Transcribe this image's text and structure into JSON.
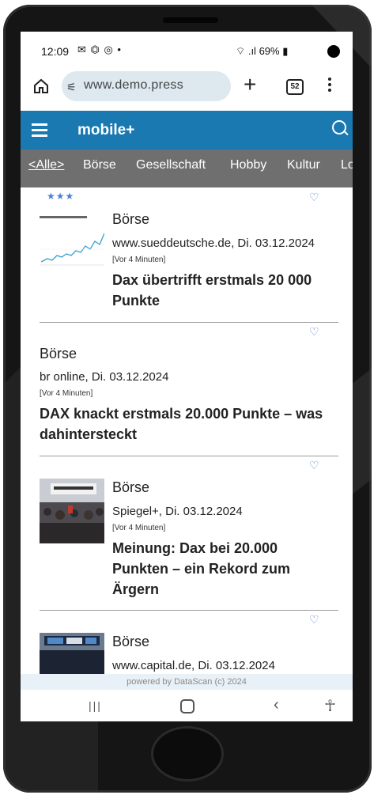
{
  "status": {
    "time": "12:09",
    "icons": "✉ ⏣ ◎ •",
    "right": "69%"
  },
  "browser": {
    "url": "www.demo.press",
    "tabs_count": "52"
  },
  "app": {
    "title": "mobile+"
  },
  "categories": [
    "<Alle>",
    "Börse",
    "Gesellschaft",
    "Hobby",
    "Kultur",
    "Lo"
  ],
  "feed": {
    "stars": "★★★",
    "articles": [
      {
        "category": "Börse",
        "source": "www.sueddeutsche.de, Di. 03.12.2024",
        "ago": "[Vor 4 Minuten]",
        "title": "Dax übertrifft erstmals 20 000 Punkte"
      },
      {
        "category": "Börse",
        "source": "br online, Di. 03.12.2024",
        "ago": "[Vor 4 Minuten]",
        "title": "DAX knackt erstmals 20.000 Punkte – was dahintersteckt"
      },
      {
        "category": "Börse",
        "source": "Spiegel+, Di. 03.12.2024",
        "ago": "[Vor 4 Minuten]",
        "title": "Meinung: Dax bei 20.000 Punkten – ein Rekord zum Ärgern"
      },
      {
        "category": "Börse",
        "source": "www.capital.de, Di. 03.12.2024"
      }
    ]
  },
  "footer": "powered by DataScan (c) 2024",
  "colors": {
    "appbar": "#1a79b1",
    "catbar": "#6f6f6f",
    "accent": "#4a7fd3"
  },
  "icons": {
    "home": "home-icon",
    "url": "site-settings-icon",
    "new_tab": "plus-icon",
    "tabs": "tab-switcher-icon",
    "menu": "more-vert-icon",
    "hamburger": "hamburger-icon",
    "search": "search-icon",
    "favorite": "heart-icon"
  }
}
